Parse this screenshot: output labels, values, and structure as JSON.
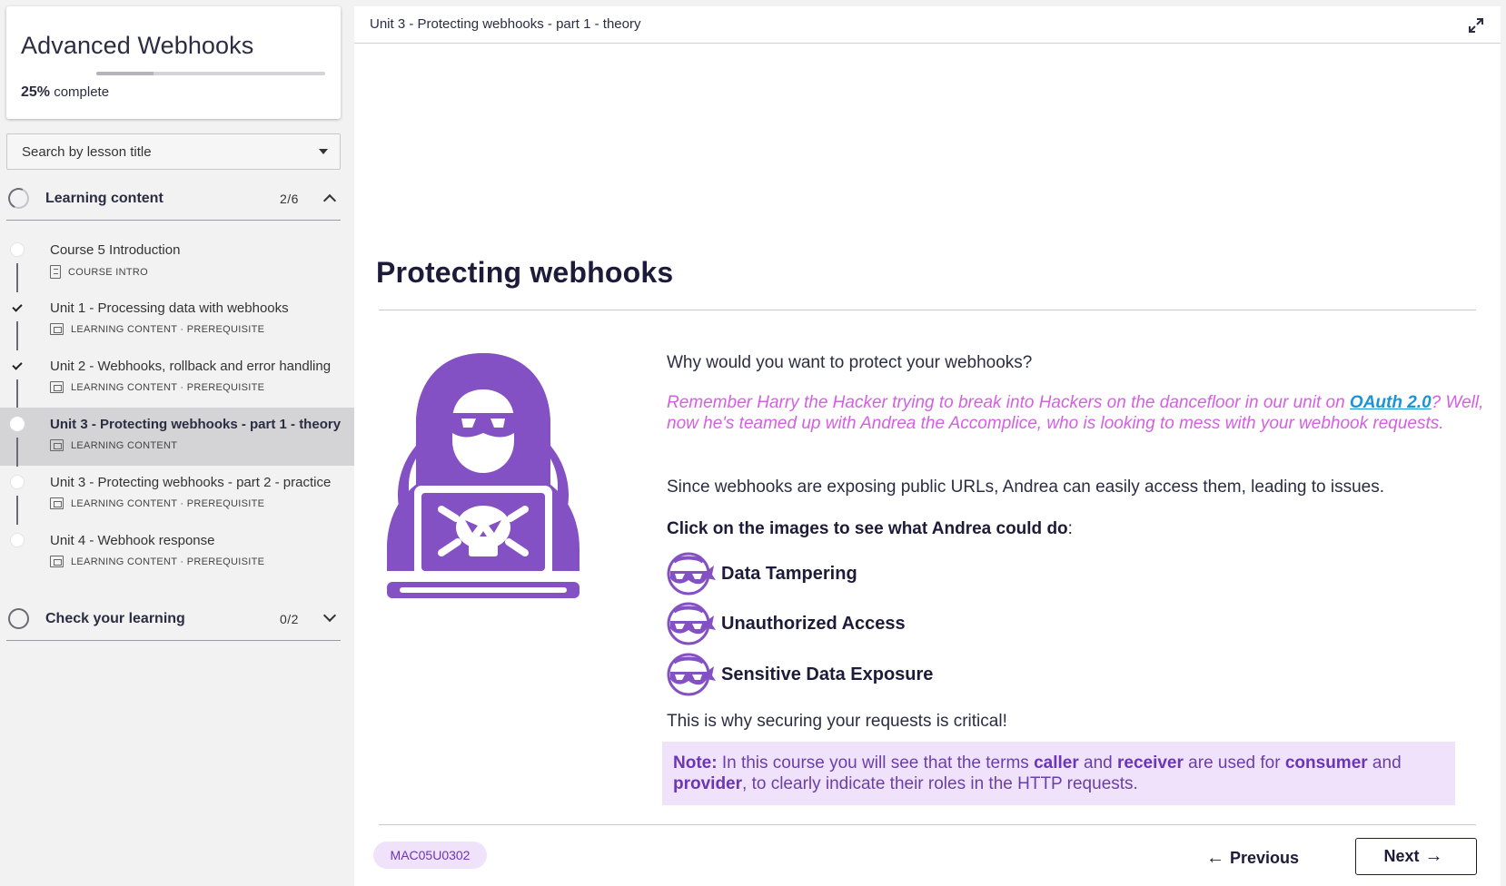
{
  "course": {
    "title": "Advanced Webhooks",
    "progress_percent": 25,
    "progress_value": "25%",
    "progress_suffix": " complete"
  },
  "search": {
    "label": "Search by lesson title"
  },
  "sections": [
    {
      "title": "Learning content",
      "count": "2/6",
      "expanded": true
    },
    {
      "title": "Check your learning",
      "count": "0/2",
      "expanded": false
    }
  ],
  "lessons": [
    {
      "title": "Course 5 Introduction",
      "meta": "COURSE INTRO",
      "status": "not-started"
    },
    {
      "title": "Unit 1 - Processing data with webhooks",
      "meta": "LEARNING CONTENT · PREREQUISITE",
      "status": "done"
    },
    {
      "title": "Unit 2 - Webhooks, rollback and error handling",
      "meta": "LEARNING CONTENT · PREREQUISITE",
      "status": "done"
    },
    {
      "title": "Unit 3 - Protecting webhooks - part 1 - theory",
      "meta": "LEARNING CONTENT",
      "status": "current"
    },
    {
      "title": "Unit 3 - Protecting webhooks - part 2 - practice",
      "meta": "LEARNING CONTENT · PREREQUISITE",
      "status": "not-started"
    },
    {
      "title": "Unit 4 - Webhook response",
      "meta": "LEARNING CONTENT · PREREQUISITE",
      "status": "not-started"
    }
  ],
  "topbar": {
    "breadcrumb": "Unit 3 - Protecting webhooks - part 1 - theory",
    "expand_icon": "expand-icon"
  },
  "page": {
    "title": "Protecting webhooks",
    "question": "Why would you want to protect your webhooks?",
    "story_before_link": "Remember Harry the Hacker trying to break into Hackers on the dancefloor in our unit on ",
    "story_link": "OAuth 2.0",
    "story_after_link": "? Well, now he's teamed up with Andrea the Accomplice, who is looking to mess with your webhook requests.",
    "exposure": "Since webhooks are exposing public URLs, Andrea can easily access them, leading to issues.",
    "instruction": "Click on the images to see what Andrea could do",
    "instruction_colon": ":",
    "threats": [
      "Data Tampering",
      "Unauthorized Access",
      "Sensitive Data Exposure"
    ],
    "conclusion": "This is why securing your requests is critical!",
    "note": {
      "label": "Note:",
      "t1": " In this course you will see that the terms ",
      "caller": "caller",
      "t2": " and ",
      "receiver": "receiver",
      "t3": " are used for ",
      "consumer": "consumer",
      "t4": " and ",
      "provider": "provider",
      "t5": ", to clearly indicate their roles in the HTTP requests."
    }
  },
  "footer": {
    "code": "MAC05U0302",
    "previous": "Previous",
    "next": "Next"
  },
  "colors": {
    "accent": "#8451c4",
    "story": "#d55fe3",
    "link": "#1a94d8",
    "note_bg": "#efe2fa"
  }
}
